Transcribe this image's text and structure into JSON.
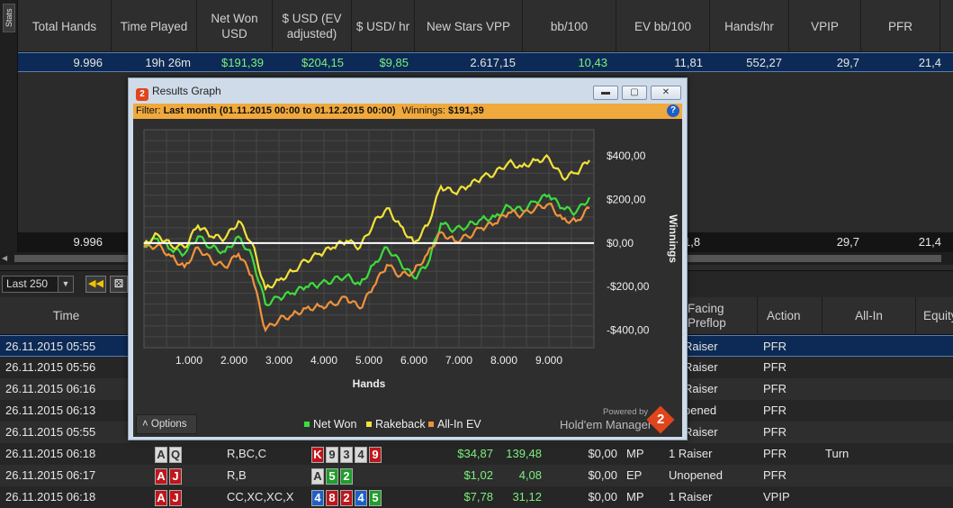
{
  "stats_tab": {
    "label": "Stats"
  },
  "stats_header": [
    {
      "label": "Total Hands"
    },
    {
      "label": "Time Played"
    },
    {
      "label": "Net Won USD"
    },
    {
      "label": "$ USD (EV adjusted)"
    },
    {
      "label": "$ USD/ hr"
    },
    {
      "label": "New Stars VPP"
    },
    {
      "label": "bb/100"
    },
    {
      "label": "EV bb/100"
    },
    {
      "label": "Hands/hr"
    },
    {
      "label": "VPIP"
    },
    {
      "label": "PFR"
    }
  ],
  "stats_row_1": {
    "total_hands": "9.996",
    "time_played": "19h 26m",
    "net_won": "$191,39",
    "ev_adjusted": "$204,15",
    "usd_hr": "$9,85",
    "vpp": "2.617,15",
    "bb100": "10,43",
    "ev_bb100": "11,81",
    "hands_hr": "552,27",
    "vpip": "29,7",
    "pfr": "21,4"
  },
  "stats_row_2": {
    "total_hands": "9.996",
    "partial": "1,8",
    "vpip": "29,7",
    "pfr": "21,4"
  },
  "toolbar": {
    "filter_value": "Last 250"
  },
  "hands_header": [
    {
      "label": "Time"
    },
    {
      "label": "Facing Preflop"
    },
    {
      "label": "Action"
    },
    {
      "label": "All-In"
    },
    {
      "label": "Equity"
    }
  ],
  "hands": [
    {
      "time": "26.11.2015 05:55",
      "facing": "Raiser",
      "action": "PFR"
    },
    {
      "time": "26.11.2015 05:56",
      "facing": "Raiser",
      "action": "PFR"
    },
    {
      "time": "26.11.2015 06:16",
      "facing": "Raiser",
      "action": "PFR"
    },
    {
      "time": "26.11.2015 06:13",
      "facing": "pened",
      "action": "PFR"
    },
    {
      "time": "26.11.2015 05:55",
      "facing": "Raiser",
      "action": "PFR"
    },
    {
      "time": "26.11.2015 06:18",
      "hole": [
        {
          "r": "A",
          "c": "gray"
        },
        {
          "r": "Q",
          "c": "gray"
        }
      ],
      "preflop": "R,BC,C",
      "board": [
        {
          "r": "K",
          "c": "red"
        },
        {
          "r": "9",
          "c": "gray"
        },
        {
          "r": "3",
          "c": "gray"
        },
        {
          "r": "4",
          "c": "gray"
        },
        {
          "r": "9",
          "c": "red"
        }
      ],
      "net": "$34,87",
      "bb": "139,48",
      "ev": "$0,00",
      "pos": "MP",
      "facing": "1 Raiser",
      "action": "PFR",
      "allin": "Turn"
    },
    {
      "time": "26.11.2015 06:17",
      "hole": [
        {
          "r": "A",
          "c": "red"
        },
        {
          "r": "J",
          "c": "red"
        }
      ],
      "preflop": "R,B",
      "board": [
        {
          "r": "A",
          "c": "gray"
        },
        {
          "r": "5",
          "c": "green"
        },
        {
          "r": "2",
          "c": "green"
        }
      ],
      "net": "$1,02",
      "bb": "4,08",
      "ev": "$0,00",
      "pos": "EP",
      "facing": "Unopened",
      "action": "PFR",
      "allin": ""
    },
    {
      "time": "26.11.2015 06:18",
      "hole": [
        {
          "r": "A",
          "c": "red"
        },
        {
          "r": "J",
          "c": "red"
        }
      ],
      "preflop": "CC,XC,XC,X",
      "board": [
        {
          "r": "4",
          "c": "blue"
        },
        {
          "r": "8",
          "c": "red"
        },
        {
          "r": "2",
          "c": "red"
        },
        {
          "r": "4",
          "c": "blue"
        },
        {
          "r": "5",
          "c": "green"
        }
      ],
      "net": "$7,78",
      "bb": "31,12",
      "ev": "$0,00",
      "pos": "MP",
      "facing": "1 Raiser",
      "action": "VPIP",
      "allin": ""
    }
  ],
  "graph_window": {
    "title": "Results Graph",
    "filter_prefix": "Filter:",
    "filter_value": "Last month (01.11.2015 00:00 to 01.12.2015 00:00)",
    "winnings_label": "Winnings:",
    "winnings_value": "$191,39",
    "options_label": "Options",
    "powered_by": "Powered by",
    "brand": "Hold'em Manager"
  },
  "chart_data": {
    "type": "line",
    "xlabel": "Hands",
    "ylabel": "Winnings",
    "xlim": [
      0,
      10000
    ],
    "ylim": [
      -480,
      520
    ],
    "x_ticks": [
      "1.000",
      "2.000",
      "3.000",
      "4.000",
      "5.000",
      "6.000",
      "7.000",
      "8.000",
      "9.000"
    ],
    "x_tick_values": [
      1000,
      2000,
      3000,
      4000,
      5000,
      6000,
      7000,
      8000,
      9000
    ],
    "y_ticks": [
      "$400,00",
      "$200,00",
      "$0,00",
      "-$200,00",
      "-$400,00"
    ],
    "y_tick_values": [
      400,
      200,
      0,
      -200,
      -400
    ],
    "grid": true,
    "legend_position": "bottom",
    "series": [
      {
        "name": "Net Won",
        "color": "#3ddc3d",
        "x": [
          0,
          300,
          600,
          900,
          1200,
          1500,
          1800,
          2100,
          2400,
          2700,
          3000,
          3300,
          3600,
          3900,
          4200,
          4500,
          4800,
          5100,
          5400,
          5700,
          6000,
          6300,
          6600,
          6900,
          7200,
          7500,
          7800,
          8100,
          8400,
          8700,
          9000,
          9300,
          9600,
          9900
        ],
        "y": [
          -10,
          20,
          -30,
          -50,
          30,
          -20,
          -40,
          30,
          -60,
          -280,
          -250,
          -230,
          -200,
          -190,
          -170,
          -150,
          -190,
          -100,
          -20,
          -90,
          -160,
          -100,
          90,
          60,
          80,
          110,
          120,
          170,
          150,
          190,
          220,
          160,
          140,
          210
        ]
      },
      {
        "name": "Rakeback",
        "color": "#f2e23a",
        "x": [
          0,
          300,
          600,
          900,
          1200,
          1500,
          1800,
          2100,
          2400,
          2700,
          3000,
          3300,
          3600,
          3900,
          4200,
          4500,
          4800,
          5100,
          5400,
          5700,
          6000,
          6300,
          6600,
          6900,
          7200,
          7500,
          7800,
          8100,
          8400,
          8700,
          9000,
          9300,
          9600,
          9900
        ],
        "y": [
          -5,
          40,
          -10,
          -20,
          80,
          30,
          20,
          100,
          0,
          -210,
          -170,
          -130,
          -80,
          -50,
          -20,
          10,
          -20,
          90,
          160,
          80,
          0,
          80,
          260,
          230,
          260,
          300,
          320,
          370,
          350,
          380,
          390,
          300,
          320,
          380
        ]
      },
      {
        "name": "All-In EV",
        "color": "#f0923a",
        "x": [
          0,
          300,
          600,
          900,
          1200,
          1500,
          1800,
          2100,
          2400,
          2700,
          3000,
          3300,
          3600,
          3900,
          4200,
          4500,
          4800,
          5100,
          5400,
          5700,
          6000,
          6300,
          6600,
          6900,
          7200,
          7500,
          7800,
          8100,
          8400,
          8700,
          9000,
          9300,
          9600,
          9900
        ],
        "y": [
          -20,
          -10,
          -60,
          -110,
          -20,
          -80,
          -110,
          -50,
          -150,
          -400,
          -350,
          -330,
          -300,
          -290,
          -280,
          -250,
          -300,
          -200,
          -100,
          -150,
          -130,
          -50,
          50,
          10,
          30,
          70,
          90,
          140,
          130,
          160,
          180,
          110,
          100,
          160
        ]
      }
    ]
  }
}
